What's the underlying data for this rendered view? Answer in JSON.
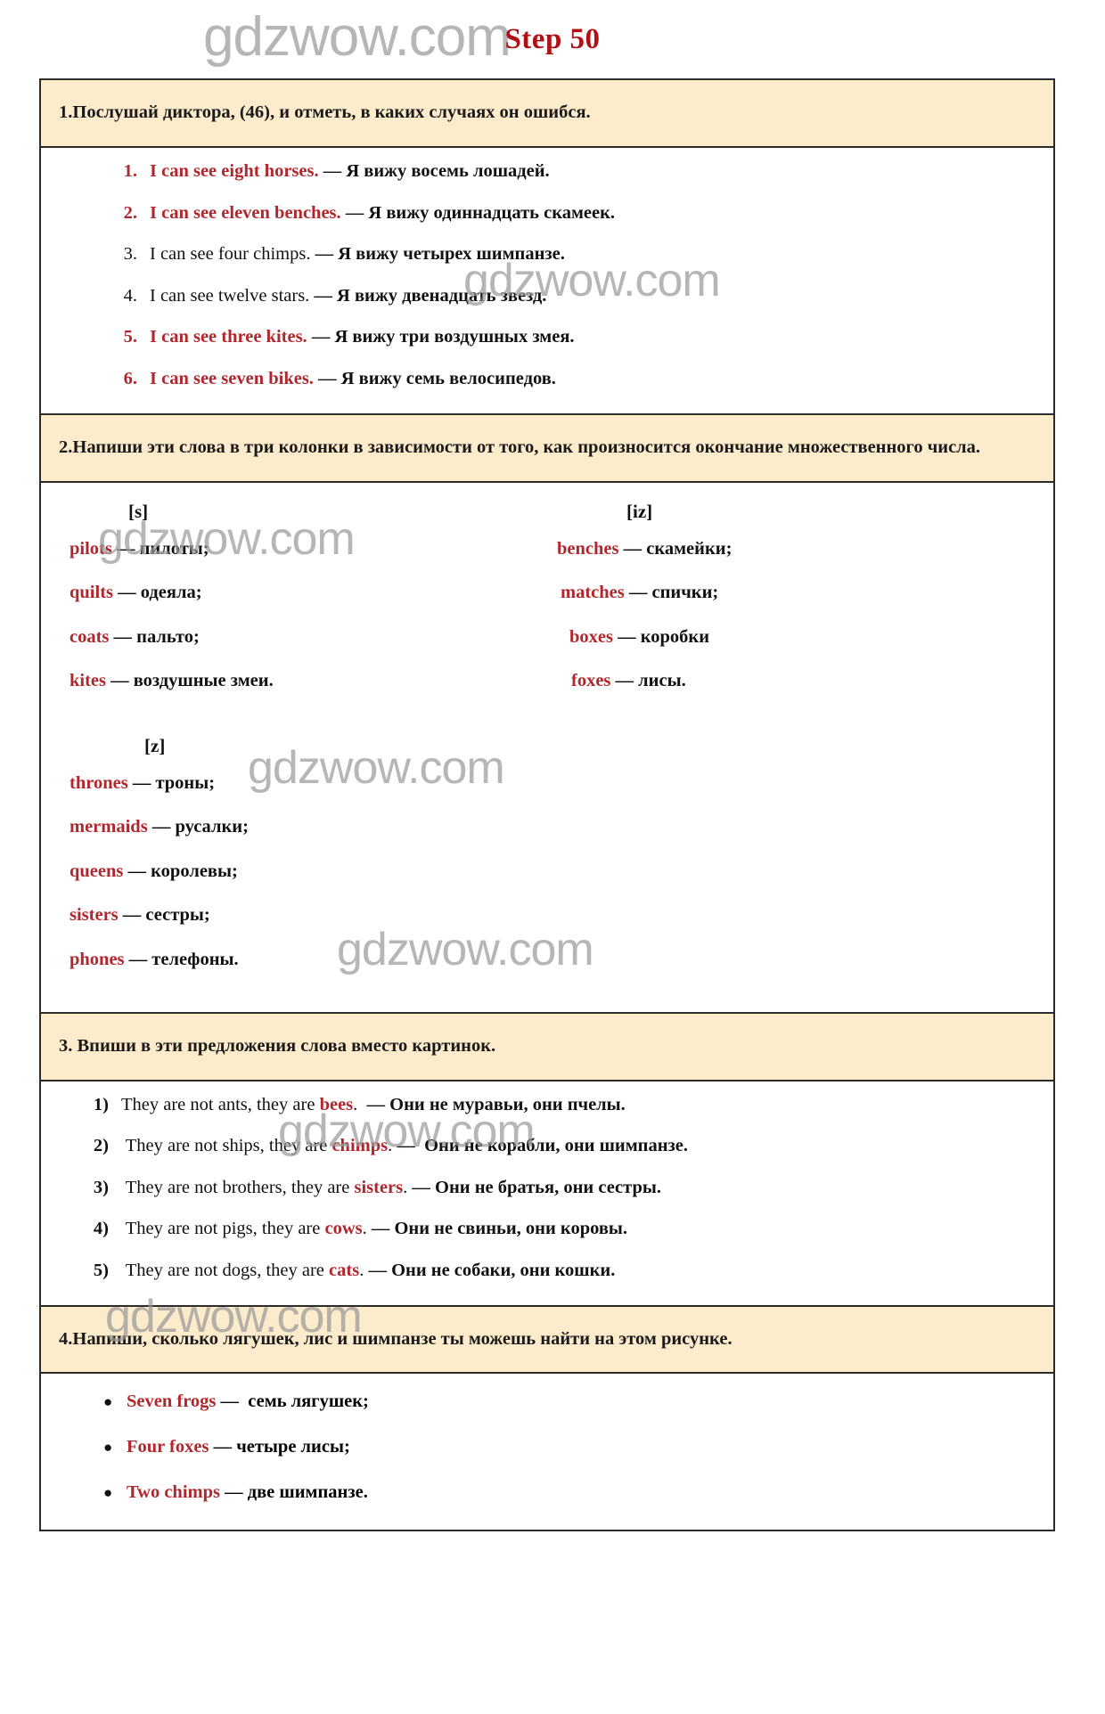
{
  "page": {
    "title": "Step 50",
    "title_color": "#b01116",
    "header_bg": "#fdeccc",
    "accent_red": "#b0282e",
    "watermark_text": "gdzwow.com"
  },
  "watermarks": [
    "gdzwow.com",
    "gdzwow.com",
    "gdzwow.com",
    "gdzwow.com",
    "gdzwow.com",
    "gdzwow.com",
    "gdzwow.com"
  ],
  "tasks": [
    {
      "id": "task-1",
      "heading": "1.Послушай диктора, (46), и отметь, в каких случаях он ошибся.",
      "items": [
        {
          "num": "1.",
          "highlight": true,
          "en": "I can see eight horses.",
          "dash": " — ",
          "ru": "Я вижу восемь лошадей."
        },
        {
          "num": "2.",
          "highlight": true,
          "en": "I can see eleven benches.",
          "dash": " — ",
          "ru": "Я вижу одиннадцать скамеек."
        },
        {
          "num": "3.",
          "highlight": false,
          "en": "I can see four chimps.",
          "dash": " — ",
          "ru": "Я вижу четырех шимпанзе."
        },
        {
          "num": "4.",
          "highlight": false,
          "en": "I can see twelve stars.",
          "dash": " — ",
          "ru": "Я вижу двенадцать звезд."
        },
        {
          "num": "5.",
          "highlight": true,
          "en": "I can see three kites.",
          "dash": " — ",
          "ru": "Я вижу три воздушных змея."
        },
        {
          "num": "6.",
          "highlight": true,
          "en": "I can see seven bikes.",
          "dash": " — ",
          "ru": "Я вижу семь велосипедов."
        }
      ]
    },
    {
      "id": "task-2",
      "heading": "2.Напиши эти слова в три колонки в зависимости от того, как произносится окончание множественного числа.",
      "columns": [
        {
          "label": "[s]",
          "pairs": [
            {
              "word": "pilots",
              "dash": " — ",
              "translation": "пилоты;"
            },
            {
              "word": "quilts",
              "dash": " — ",
              "translation": "одеяла;"
            },
            {
              "word": "coats",
              "dash": " — ",
              "translation": "пальто;"
            },
            {
              "word": "kites",
              "dash": " — ",
              "translation": "воздушные змеи."
            }
          ]
        },
        {
          "label": "[iz]",
          "pairs": [
            {
              "word": "benches",
              "dash": " — ",
              "translation": "скамейки;"
            },
            {
              "word": "matches",
              "dash": " — ",
              "translation": "спички;"
            },
            {
              "word": "boxes",
              "dash": " — ",
              "translation": "коробки"
            },
            {
              "word": "foxes",
              "dash": " — ",
              "translation": "лисы."
            }
          ]
        },
        {
          "label": "[z]",
          "pairs": [
            {
              "word": "thrones",
              "dash": " — ",
              "translation": "троны;"
            },
            {
              "word": "mermaids",
              "dash": " — ",
              "translation": "русалки;"
            },
            {
              "word": "queens",
              "dash": " — ",
              "translation": "королевы;"
            },
            {
              "word": "sisters",
              "dash": " — ",
              "translation": "сестры;"
            },
            {
              "word": "phones",
              "dash": " — ",
              "translation": "телефоны."
            }
          ]
        }
      ]
    },
    {
      "id": "task-3",
      "heading": "3. Впиши в эти предложения слова вместо картинок.",
      "items": [
        {
          "num": "1)",
          "en_before": "They are not ants, they are ",
          "answer": "bees",
          "en_after": ".",
          "dash": "  — ",
          "ru": "Они не муравьи, они пчелы."
        },
        {
          "num": "2)",
          "en_before": " They are not ships, they are ",
          "answer": "chimps",
          "en_after": ". ",
          "dash": "—  ",
          "ru": "Они не корабли, они шимпанзе."
        },
        {
          "num": "3)",
          "en_before": " They are not brothers, they are ",
          "answer": "sisters",
          "en_after": ".",
          "dash": " — ",
          "ru": "Они не братья, они сестры."
        },
        {
          "num": "4)",
          "en_before": " They are not pigs, they are ",
          "answer": "cows",
          "en_after": ".",
          "dash": " — ",
          "ru": "Они не свиньи, они коровы."
        },
        {
          "num": "5)",
          "en_before": " They are not dogs, they are ",
          "answer": "cats",
          "en_after": ".",
          "dash": " — ",
          "ru": "Они не собаки, они кошки."
        }
      ]
    },
    {
      "id": "task-4",
      "heading": "4.Напиши, сколько лягушек, лис и шимпанзе ты можешь найти на этом рисунке.",
      "bullets": [
        {
          "en": "Seven frogs",
          "dash": " —  ",
          "ru": "семь лягушек;"
        },
        {
          "en": "Four foxes",
          "dash": " — ",
          "ru": "четыре лисы;"
        },
        {
          "en": "Two chimps",
          "dash": " — ",
          "ru": "две шимпанзе."
        }
      ]
    }
  ]
}
